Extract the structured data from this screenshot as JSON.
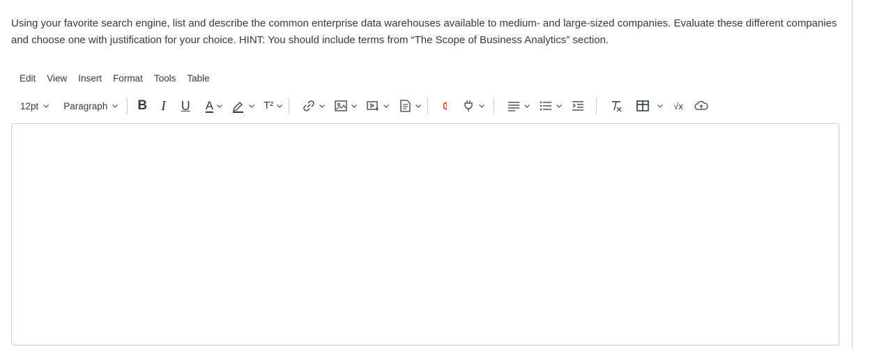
{
  "question": {
    "text": "Using your favorite search engine, list and describe the common enterprise data warehouses available to medium- and large-sized companies. Evaluate these different companies and choose one with justification for your choice. HINT: You should include terms from “The Scope of Business Analytics” section."
  },
  "menubar": {
    "items": [
      {
        "label": "Edit"
      },
      {
        "label": "View"
      },
      {
        "label": "Insert"
      },
      {
        "label": "Format"
      },
      {
        "label": "Tools"
      },
      {
        "label": "Table"
      }
    ]
  },
  "toolbar": {
    "font_size": "12pt",
    "block_format": "Paragraph",
    "bold": "B",
    "italic": "I",
    "underline": "U",
    "text_color": "A",
    "superscript": "T²",
    "equation": "√x",
    "icons": {
      "link": "link-icon",
      "image": "image-icon",
      "media": "media-icon",
      "document": "document-icon",
      "office": "office-icon",
      "apps": "apps-plug-icon",
      "align": "align-icon",
      "list": "list-icon",
      "indent": "indent-icon",
      "clear": "clear-formatting-icon",
      "table": "table-icon",
      "upload": "cloud-upload-icon"
    },
    "colors": {
      "office_accent": "#e43e1c",
      "text": "#2d3b45",
      "border": "#c7cdd1"
    }
  },
  "editor": {
    "content": ""
  }
}
